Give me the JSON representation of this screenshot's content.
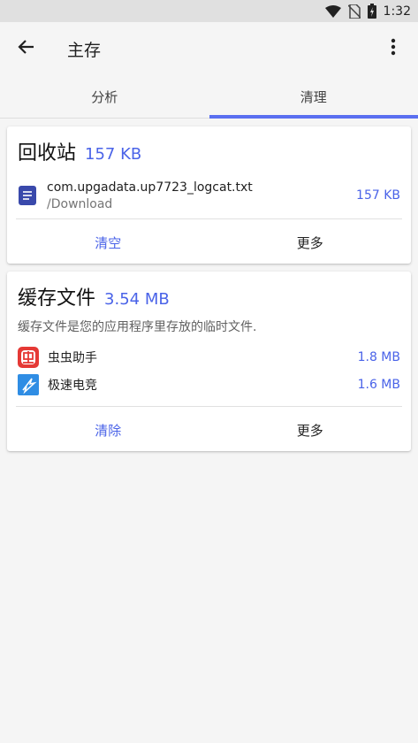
{
  "status_bar": {
    "time": "1:32",
    "icons": [
      "wifi-icon",
      "no-sim-icon",
      "battery-charging-icon"
    ]
  },
  "app_bar": {
    "title": "主存",
    "back_icon": "arrow-back-icon",
    "more_icon": "more-vert-icon"
  },
  "tabs": [
    {
      "label": "分析",
      "active": false
    },
    {
      "label": "清理",
      "active": true
    }
  ],
  "colors": {
    "accent": "#5a6ff0",
    "size_text": "#4a63e8",
    "file_icon": "#3949ab",
    "app1_icon": "#e53935",
    "app2_icon": "#2f8de4"
  },
  "recycle_bin": {
    "title": "回收站",
    "size": "157 KB",
    "file": {
      "name": "com.upgadata.up7723_logcat.txt",
      "path": "/Download",
      "size": "157 KB"
    },
    "actions": {
      "primary": "清空",
      "secondary": "更多"
    }
  },
  "cache": {
    "title": "缓存文件",
    "size": "3.54 MB",
    "description": "缓存文件是您的应用程序里存放的临时文件.",
    "apps": [
      {
        "name": "虫虫助手",
        "size": "1.8 MB",
        "icon": "chongchong-app-icon"
      },
      {
        "name": "极速电竞",
        "size": "1.6 MB",
        "icon": "jisu-esports-app-icon"
      }
    ],
    "actions": {
      "primary": "清除",
      "secondary": "更多"
    }
  }
}
